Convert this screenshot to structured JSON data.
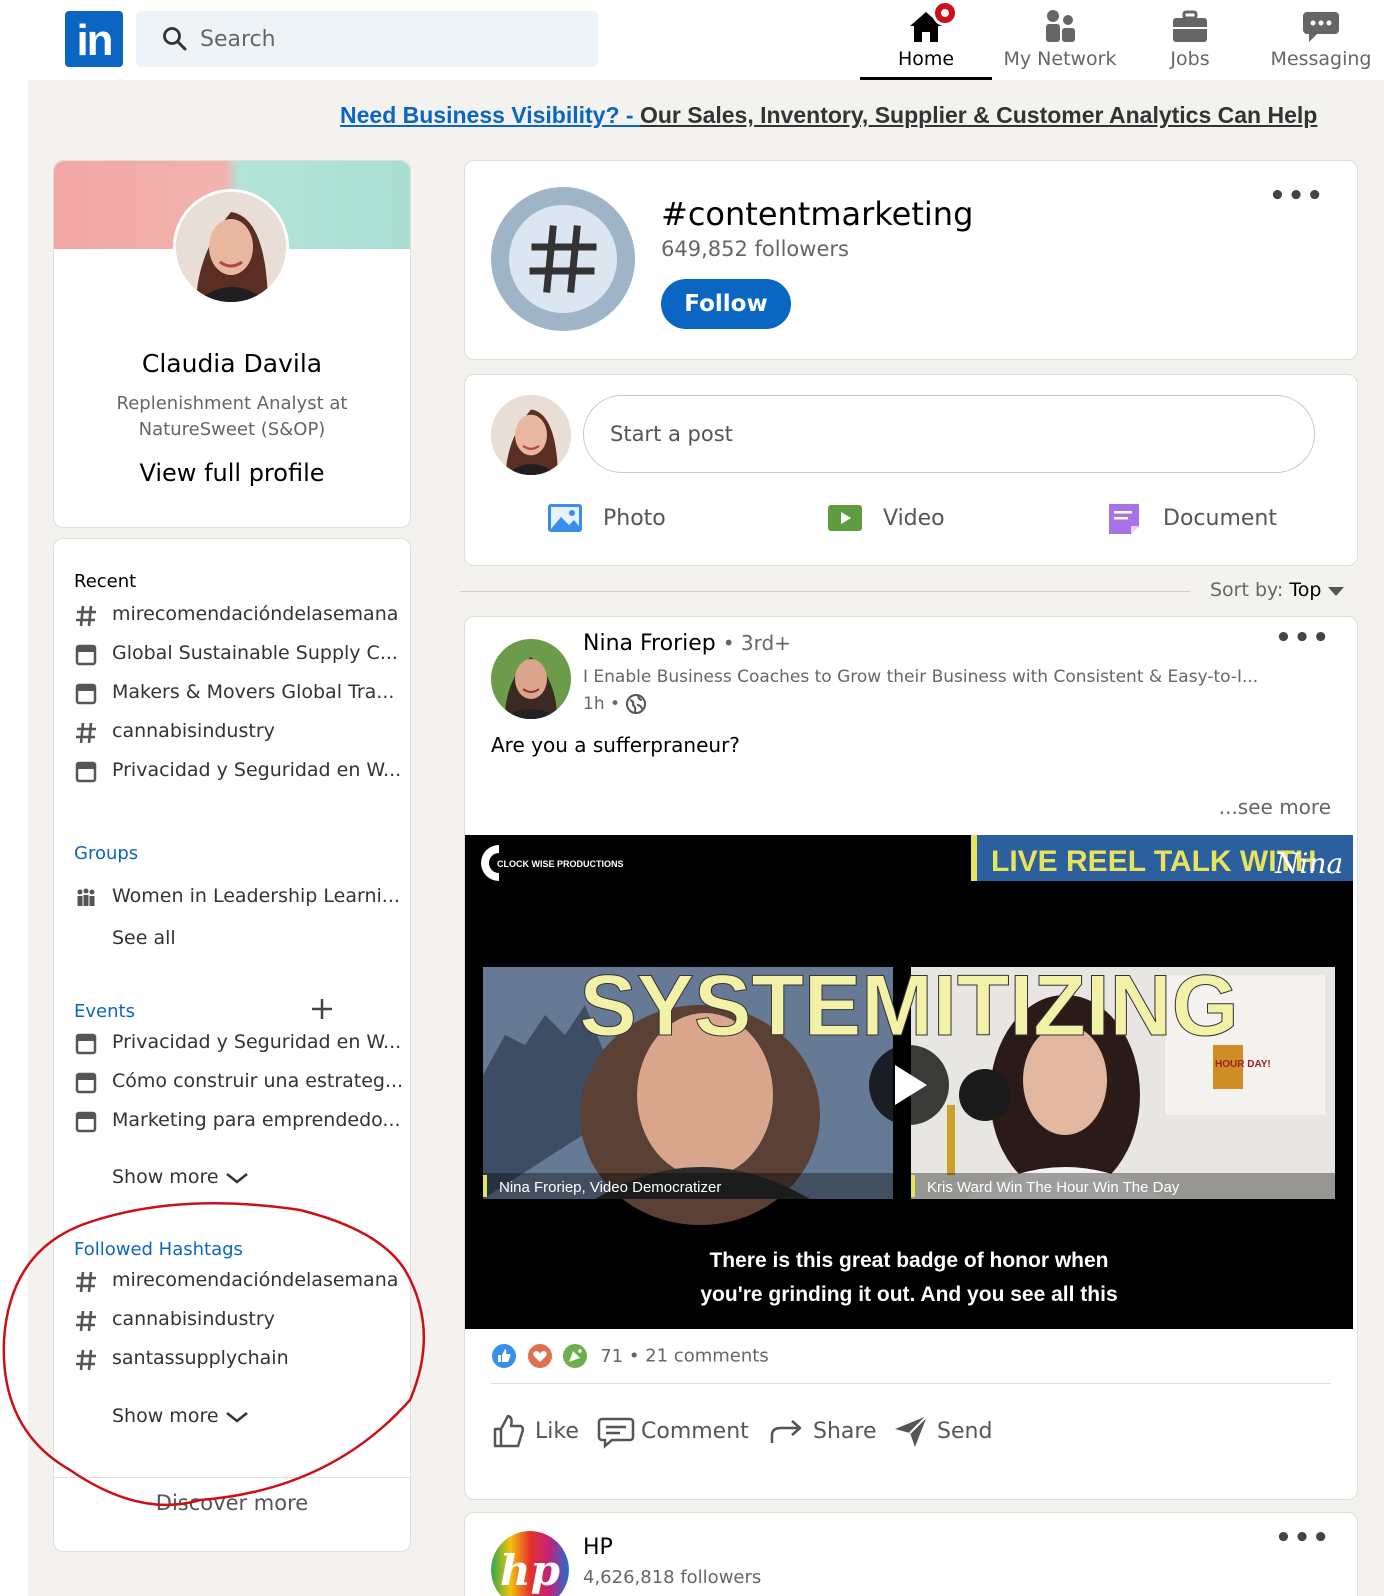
{
  "nav": {
    "logo": "in",
    "search_placeholder": "Search",
    "items": [
      {
        "label": "Home",
        "icon": "home-icon",
        "active": true
      },
      {
        "label": "My Network",
        "icon": "network-icon"
      },
      {
        "label": "Jobs",
        "icon": "briefcase-icon"
      },
      {
        "label": "Messaging",
        "icon": "messaging-icon"
      }
    ]
  },
  "ad": {
    "part1": "Need Business Visibility? - ",
    "part2": "Our Sales, Inventory, Supplier & Customer Analytics Can Help"
  },
  "profile": {
    "name": "Claudia Davila",
    "headline": "Replenishment Analyst at NatureSweet (S&OP)",
    "view_profile": "View full profile"
  },
  "sidebar": {
    "recent_title": "Recent",
    "recent": [
      {
        "label": "mirecomendacióndelasemana",
        "icon": "hashtag-icon"
      },
      {
        "label": "Global Sustainable Supply C...",
        "icon": "calendar-icon"
      },
      {
        "label": "Makers & Movers Global Tra...",
        "icon": "calendar-icon"
      },
      {
        "label": "cannabisindustry",
        "icon": "hashtag-icon"
      },
      {
        "label": "Privacidad y Seguridad en W...",
        "icon": "calendar-icon"
      }
    ],
    "groups_title": "Groups",
    "groups": [
      {
        "label": "Women in Leadership Learni...",
        "icon": "group-icon"
      }
    ],
    "groups_see_all": "See all",
    "events_title": "Events",
    "events": [
      {
        "label": "Privacidad y Seguridad en W...",
        "icon": "calendar-icon"
      },
      {
        "label": "Cómo construir una estrateg...",
        "icon": "calendar-icon"
      },
      {
        "label": "Marketing para emprendedo...",
        "icon": "calendar-icon"
      }
    ],
    "events_show_more": "Show more",
    "hashtags_title": "Followed Hashtags",
    "hashtags": [
      {
        "label": "mirecomendacióndelasemana",
        "icon": "hashtag-icon"
      },
      {
        "label": "cannabisindustry",
        "icon": "hashtag-icon"
      },
      {
        "label": "santassupplychain",
        "icon": "hashtag-icon"
      }
    ],
    "hashtags_show_more": "Show more",
    "discover_more": "Discover more"
  },
  "hashtag_card": {
    "title": "#contentmarketing",
    "followers": "649,852 followers",
    "follow_label": "Follow"
  },
  "composer": {
    "placeholder": "Start a post",
    "actions": [
      {
        "label": "Photo",
        "icon": "photo-icon",
        "color": "#378fe9"
      },
      {
        "label": "Video",
        "icon": "video-icon",
        "color": "#5f9b41"
      },
      {
        "label": "Document",
        "icon": "document-icon",
        "color": "#a872e8"
      }
    ]
  },
  "sort": {
    "label": "Sort by:",
    "value": "Top"
  },
  "post": {
    "author": "Nina Froriep",
    "degree": "• 3rd+",
    "subtitle": "I Enable Business Coaches to Grow their Business with Consistent & Easy-to-I...",
    "time": "1h •",
    "text": "Are you a sufferpraneur?",
    "see_more": "...see more",
    "video": {
      "brand": "CLOCK WISE PRODUCTIONS",
      "banner": "LIVE REEL TALK WITH",
      "banner_sig": "Nina",
      "headline": "SYSTEMITIZING",
      "left_caption": "Nina Froriep, Video Democratizer",
      "right_caption": "Kris Ward Win The Hour Win The Day",
      "book": "HOUR DAY!",
      "subtitle_line1": "There is this great badge of honor when",
      "subtitle_line2": "you're grinding it out. And you see all this"
    },
    "reactions_count": "71",
    "comments": "• 21 comments",
    "actions": [
      {
        "label": "Like",
        "icon": "like-icon"
      },
      {
        "label": "Comment",
        "icon": "comment-icon"
      },
      {
        "label": "Share",
        "icon": "share-icon"
      },
      {
        "label": "Send",
        "icon": "send-icon"
      }
    ]
  },
  "next_post": {
    "name": "HP",
    "followers": "4,626,818 followers",
    "logo_text": "hp"
  },
  "colors": {
    "brand": "#0a66c2",
    "annotation": "#cc1016",
    "page_bg": "#f3f2ef"
  }
}
